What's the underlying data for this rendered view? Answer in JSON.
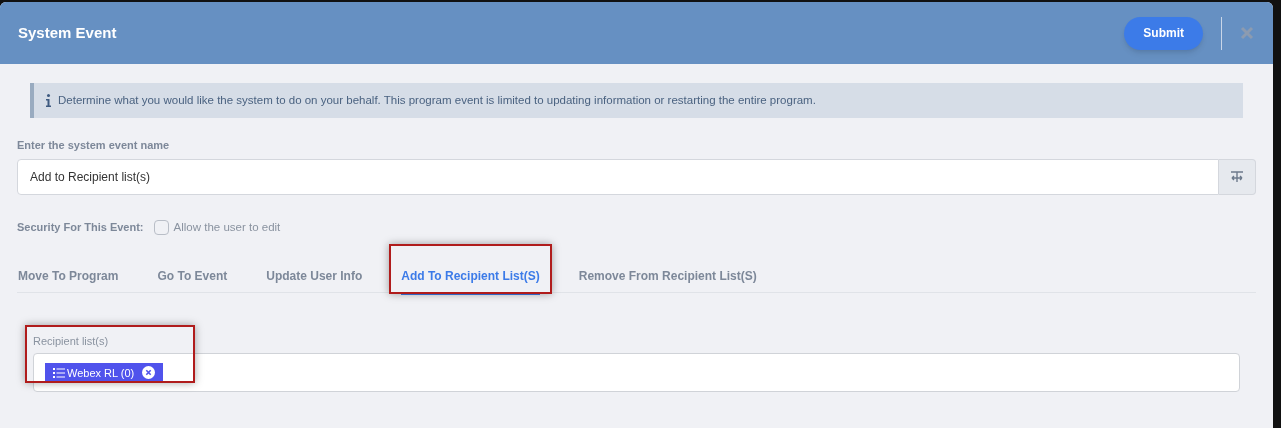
{
  "window": {
    "title": "System Event",
    "submit": "Submit"
  },
  "info": "Determine what you would like the system to do on your behalf. This program event is limited to updating information or restarting the entire program.",
  "name_field": {
    "label": "Enter the system event name",
    "value": "Add to Recipient list(s)"
  },
  "security": {
    "label": "Security For This Event:",
    "option": "Allow the user to edit",
    "checked": false
  },
  "tabs": [
    {
      "label": "Move To Program",
      "selected": false,
      "highlighted": false
    },
    {
      "label": "Go To Event",
      "selected": false,
      "highlighted": false
    },
    {
      "label": "Update User Info",
      "selected": false,
      "highlighted": false
    },
    {
      "label": "Add To Recipient List(S)",
      "selected": true,
      "highlighted": true
    },
    {
      "label": "Remove From Recipient List(S)",
      "selected": false,
      "highlighted": false
    }
  ],
  "recipients": {
    "label": "Recipient list(s)",
    "highlighted": true,
    "chips": [
      {
        "label": "Webex RL (0)"
      }
    ]
  }
}
